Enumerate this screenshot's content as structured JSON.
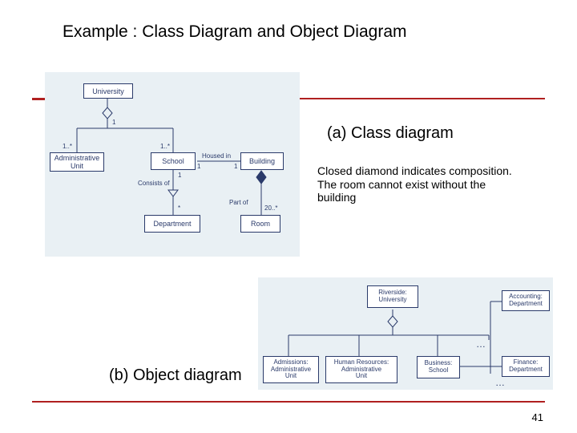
{
  "title": "Example : Class Diagram and Object Diagram",
  "caption_a": "(a) Class diagram",
  "caption_b": "(b) Object diagram",
  "note_text": "Closed diamond indicates composition. The room cannot exist without the building",
  "page_number": "41",
  "class_diagram": {
    "classes": {
      "university": "University",
      "admin_unit": "Administrative\nUnit",
      "school": "School",
      "building": "Building",
      "department": "Department",
      "room": "Room"
    },
    "assoc_labels": {
      "housed_in": "Housed in",
      "consists_of": "Consists of",
      "part_of": "Part of"
    },
    "multiplicities": {
      "uni_bottom": "1",
      "admin_top": "1..*",
      "school_top": "1..*",
      "school_to_building_left": "1",
      "school_to_building_right": "1",
      "school_to_dept_top": "1",
      "school_to_dept_bottom": "*",
      "room_top": "20..*"
    }
  },
  "object_diagram": {
    "objects": {
      "riverside": "Riverside:\nUniversity",
      "admissions": "Admissions:\nAdministrative\nUnit",
      "hr": "Human Resources:\nAdministrative\nUnit",
      "business": "Business:\nSchool",
      "accounting": "Accounting:\nDepartment",
      "finance": "Finance:\nDepartment"
    },
    "ellipsis": "…"
  }
}
